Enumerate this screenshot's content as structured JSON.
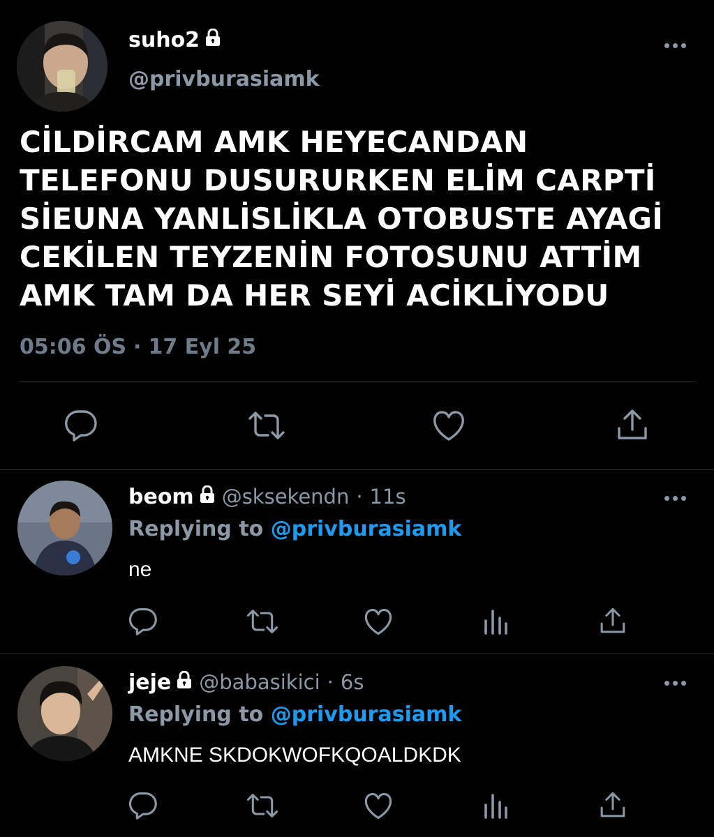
{
  "main_tweet": {
    "author_name": "suho2",
    "author_handle": "@privburasiamk",
    "text_lines": [
      "CİLDİRCAM AMK HEYECANDAN",
      "TELEFONU DUSURURKEN ELİM CARPTİ",
      "SİEUNA YANLİSLİKLA OTOBUSTE AYAGİ",
      "CEKİLEN TEYZENİN FOTOSUNU ATTİM",
      "AMK TAM DA HER SEYİ ACİKLİYODU"
    ],
    "time": "05:06 ÖS",
    "separator": "·",
    "date": "17 Eyl 25",
    "actions": [
      "reply-icon",
      "retweet-icon",
      "like-icon",
      "share-icon"
    ]
  },
  "replies": [
    {
      "name": "beom",
      "handle": "@sksekendn",
      "dot": "·",
      "time": "11s",
      "replying_prefix": "Replying to",
      "replying_to": "@privburasiamk",
      "text": "ne",
      "actions": [
        "reply-icon",
        "retweet-icon",
        "like-icon",
        "analytics-icon",
        "share-icon"
      ]
    },
    {
      "name": "jeje",
      "handle": "@babasikici",
      "dot": "·",
      "time": "6s",
      "replying_prefix": "Replying to",
      "replying_to": "@privburasiamk",
      "text": "AMKNE SKDOKWOFKQOALDKDK",
      "actions": [
        "reply-icon",
        "retweet-icon",
        "like-icon",
        "analytics-icon",
        "share-icon"
      ]
    }
  ],
  "colors": {
    "background": "#000000",
    "text": "#ffffff",
    "muted": "#8b98a5",
    "link": "#1d9bf0",
    "divider": "#2f3336"
  }
}
